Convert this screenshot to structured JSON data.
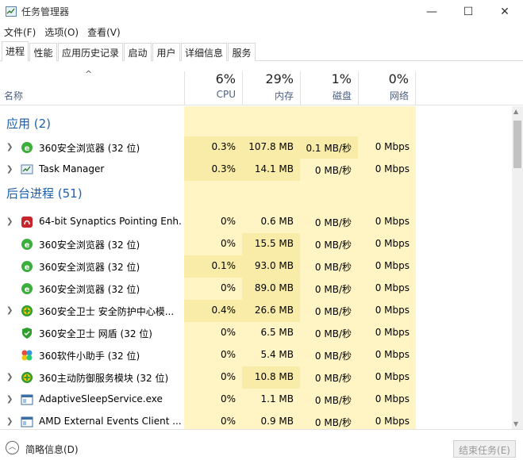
{
  "window": {
    "title": "任务管理器",
    "minimize": "—",
    "maximize": "☐",
    "close": "✕"
  },
  "menu": [
    "文件(F)",
    "选项(O)",
    "查看(V)"
  ],
  "tabs": [
    "进程",
    "性能",
    "应用历史记录",
    "启动",
    "用户",
    "详细信息",
    "服务"
  ],
  "active_tab": "进程",
  "columns": {
    "name": "名称",
    "sort_indicator": "^",
    "metrics": [
      {
        "percent": "6%",
        "label": "CPU"
      },
      {
        "percent": "29%",
        "label": "内存"
      },
      {
        "percent": "1%",
        "label": "磁盘"
      },
      {
        "percent": "0%",
        "label": "网络"
      }
    ]
  },
  "groups": [
    {
      "title": "应用 (2)",
      "processes": [
        {
          "name": "360安全浏览器 (32 位)",
          "icon": "360-browser-icon",
          "expandable": true,
          "cpu": "0.3%",
          "memory": "107.8 MB",
          "disk": "0.1 MB/秒",
          "network": "0 Mbps"
        },
        {
          "name": "Task Manager",
          "icon": "task-manager-icon",
          "expandable": true,
          "cpu": "0.3%",
          "memory": "14.1 MB",
          "disk": "0 MB/秒",
          "network": "0 Mbps"
        }
      ]
    },
    {
      "title": "后台进程 (51)",
      "processes": [
        {
          "name": "64-bit Synaptics Pointing Enh...",
          "icon": "synaptics-icon",
          "expandable": true,
          "cpu": "0%",
          "memory": "0.6 MB",
          "disk": "0 MB/秒",
          "network": "0 Mbps"
        },
        {
          "name": "360安全浏览器 (32 位)",
          "icon": "360-browser-icon",
          "expandable": false,
          "cpu": "0%",
          "memory": "15.5 MB",
          "disk": "0 MB/秒",
          "network": "0 Mbps"
        },
        {
          "name": "360安全浏览器 (32 位)",
          "icon": "360-browser-icon",
          "expandable": false,
          "cpu": "0.1%",
          "memory": "93.0 MB",
          "disk": "0 MB/秒",
          "network": "0 Mbps"
        },
        {
          "name": "360安全浏览器 (32 位)",
          "icon": "360-browser-icon",
          "expandable": false,
          "cpu": "0%",
          "memory": "89.0 MB",
          "disk": "0 MB/秒",
          "network": "0 Mbps"
        },
        {
          "name": "360安全卫士 安全防护中心模...",
          "icon": "360-safeguard-icon",
          "expandable": true,
          "cpu": "0.4%",
          "memory": "26.6 MB",
          "disk": "0 MB/秒",
          "network": "0 Mbps"
        },
        {
          "name": "360安全卫士 网盾 (32 位)",
          "icon": "360-netshield-icon",
          "expandable": false,
          "cpu": "0%",
          "memory": "6.5 MB",
          "disk": "0 MB/秒",
          "network": "0 Mbps"
        },
        {
          "name": "360软件小助手 (32 位)",
          "icon": "360-software-helper-icon",
          "expandable": false,
          "cpu": "0%",
          "memory": "5.4 MB",
          "disk": "0 MB/秒",
          "network": "0 Mbps"
        },
        {
          "name": "360主动防御服务模块 (32 位)",
          "icon": "360-safeguard-icon",
          "expandable": true,
          "cpu": "0%",
          "memory": "10.8 MB",
          "disk": "0 MB/秒",
          "network": "0 Mbps"
        },
        {
          "name": "AdaptiveSleepService.exe",
          "icon": "service-window-icon",
          "expandable": true,
          "cpu": "0%",
          "memory": "1.1 MB",
          "disk": "0 MB/秒",
          "network": "0 Mbps"
        },
        {
          "name": "AMD External Events Client ...",
          "icon": "service-window-icon",
          "expandable": true,
          "cpu": "0%",
          "memory": "0.9 MB",
          "disk": "0 MB/秒",
          "network": "0 Mbps"
        }
      ]
    }
  ],
  "footer": {
    "fewer_details": "简略信息(D)",
    "end_task": "结束任务(E)"
  },
  "colors": {
    "heat_light": "#fff4c4",
    "heat_medium": "#f9eca8",
    "group_title": "#1e5fab",
    "header_label": "#4d6082"
  }
}
